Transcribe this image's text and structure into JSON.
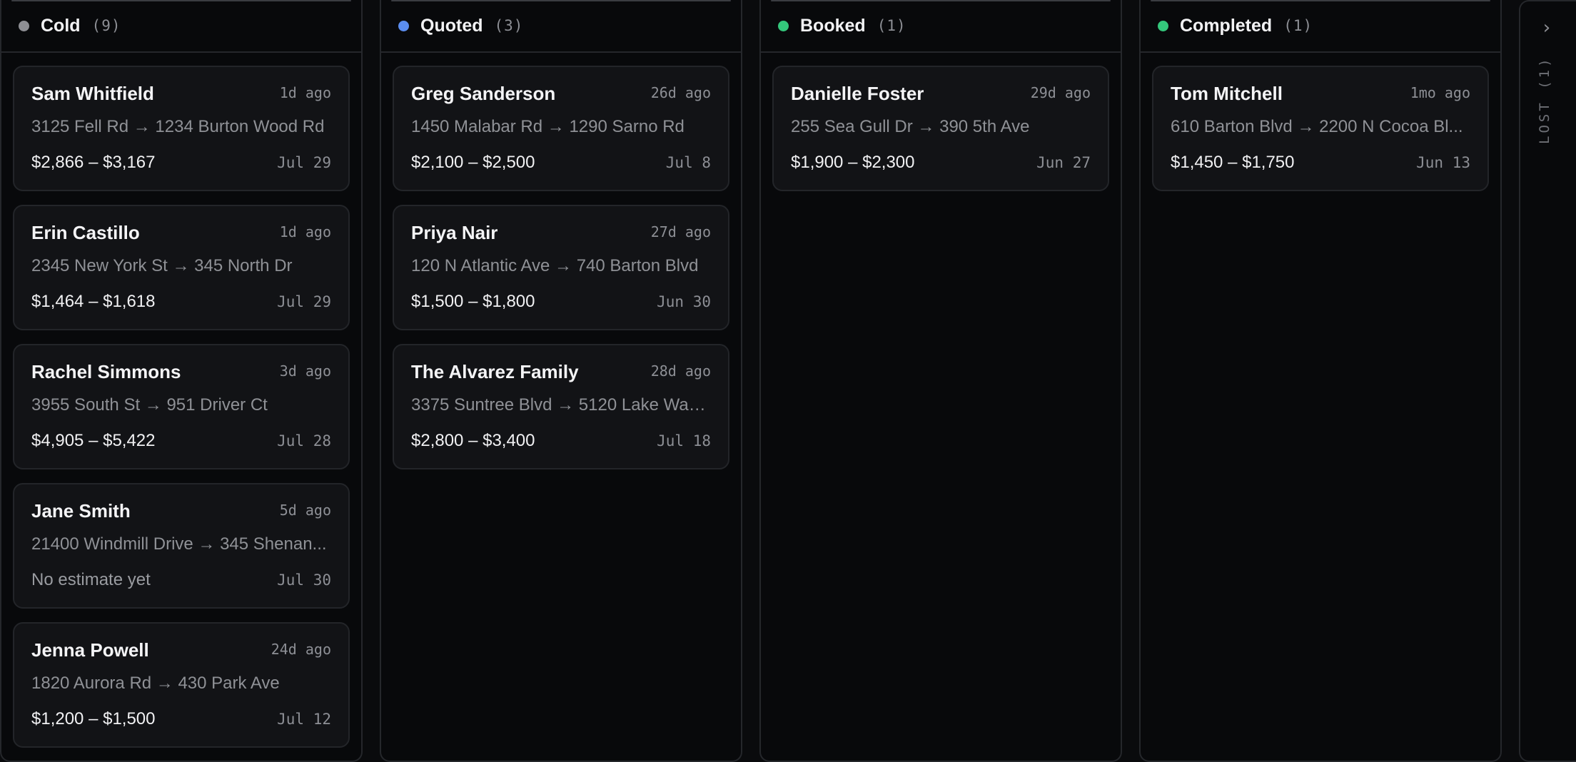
{
  "columns": [
    {
      "title": "Cold",
      "count": "(9)",
      "dot_color": "#8e8f94",
      "cards": [
        {
          "name": "Sam Whitfield",
          "ago": "1d ago",
          "route": "3125 Fell Rd → 1234 Burton Wood Rd",
          "price": "$2,866 – $3,167",
          "date": "Jul 29"
        },
        {
          "name": "Erin Castillo",
          "ago": "1d ago",
          "route": "2345 New York St → 345 North Dr",
          "price": "$1,464 – $1,618",
          "date": "Jul 29"
        },
        {
          "name": "Rachel Simmons",
          "ago": "3d ago",
          "route": "3955 South St → 951 Driver Ct",
          "price": "$4,905 – $5,422",
          "date": "Jul 28"
        },
        {
          "name": "Jane Smith",
          "ago": "5d ago",
          "route": "21400 Windmill Drive → 345 Shenan...",
          "price": "No estimate yet",
          "date": "Jul 30"
        },
        {
          "name": "Jenna Powell",
          "ago": "24d ago",
          "route": "1820 Aurora Rd → 430 Park Ave",
          "price": "$1,200 – $1,500",
          "date": "Jul 12"
        }
      ]
    },
    {
      "title": "Quoted",
      "count": "(3)",
      "dot_color": "#5b8def",
      "cards": [
        {
          "name": "Greg Sanderson",
          "ago": "26d ago",
          "route": "1450 Malabar Rd → 1290 Sarno Rd",
          "price": "$2,100 – $2,500",
          "date": "Jul 8"
        },
        {
          "name": "Priya Nair",
          "ago": "27d ago",
          "route": "120 N Atlantic Ave → 740 Barton Blvd",
          "price": "$1,500 – $1,800",
          "date": "Jun 30"
        },
        {
          "name": "The Alvarez Family",
          "ago": "28d ago",
          "route": "3375 Suntree Blvd → 5120 Lake Was...",
          "price": "$2,800 – $3,400",
          "date": "Jul 18"
        }
      ]
    },
    {
      "title": "Booked",
      "count": "(1)",
      "dot_color": "#34c77b",
      "cards": [
        {
          "name": "Danielle Foster",
          "ago": "29d ago",
          "route": "255 Sea Gull Dr → 390 5th Ave",
          "price": "$1,900 – $2,300",
          "date": "Jun 27"
        }
      ]
    },
    {
      "title": "Completed",
      "count": "(1)",
      "dot_color": "#34c77b",
      "cards": [
        {
          "name": "Tom Mitchell",
          "ago": "1mo ago",
          "route": "610 Barton Blvd → 2200 N Cocoa Bl...",
          "price": "$1,450 – $1,750",
          "date": "Jun 13"
        }
      ]
    }
  ],
  "lost": {
    "label": "LOST (1)",
    "chevron_icon": "chevron-right-icon"
  }
}
